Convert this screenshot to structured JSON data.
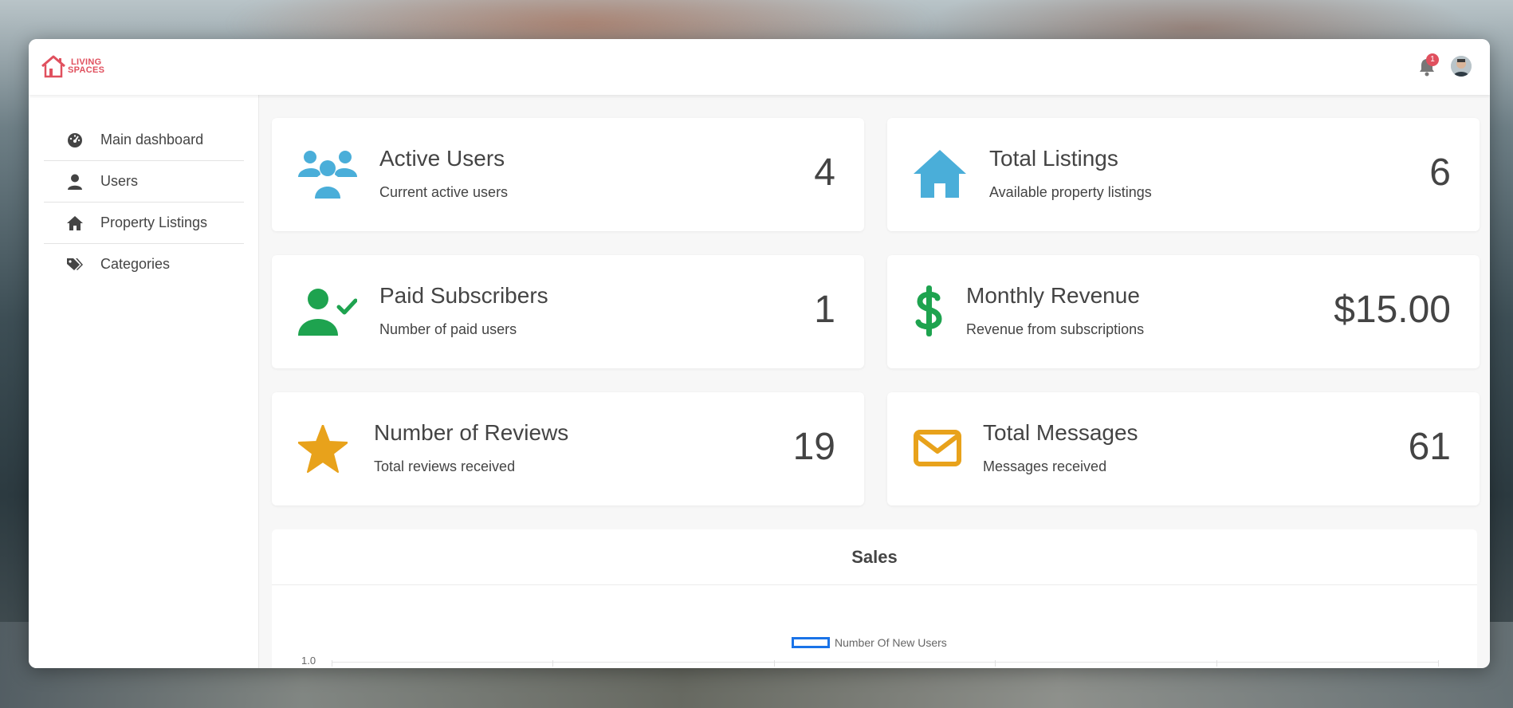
{
  "app": {
    "logo_line1": "LIVING",
    "logo_line2": "SPACES",
    "notification_count": "1",
    "brand_color": "#e0505e"
  },
  "sidebar": {
    "items": [
      {
        "label": "Main dashboard",
        "icon": "gauge-icon"
      },
      {
        "label": "Users",
        "icon": "user-icon"
      },
      {
        "label": "Property Listings",
        "icon": "home-icon"
      },
      {
        "label": "Categories",
        "icon": "tags-icon"
      }
    ]
  },
  "stats": {
    "active_users": {
      "title": "Active Users",
      "subtitle": "Current active users",
      "value": "4",
      "icon": "users-group-icon",
      "color": "#4aaed9"
    },
    "total_listings": {
      "title": "Total Listings",
      "subtitle": "Available property listings",
      "value": "6",
      "icon": "house-icon",
      "color": "#4aaed9"
    },
    "paid_subscribers": {
      "title": "Paid Subscribers",
      "subtitle": "Number of paid users",
      "value": "1",
      "icon": "user-check-icon",
      "color": "#1ea34f"
    },
    "monthly_revenue": {
      "title": "Monthly Revenue",
      "subtitle": "Revenue from subscriptions",
      "value": "$15.00",
      "icon": "dollar-icon",
      "color": "#1ea34f"
    },
    "reviews": {
      "title": "Number of Reviews",
      "subtitle": "Total reviews received",
      "value": "19",
      "icon": "star-icon",
      "color": "#e8a21b"
    },
    "messages": {
      "title": "Total Messages",
      "subtitle": "Messages received",
      "value": "61",
      "icon": "envelope-icon",
      "color": "#e8a21b"
    }
  },
  "sales": {
    "title": "Sales",
    "legend": "Number Of New Users",
    "ytick_top": "1.0",
    "series_color": "#1a73e8"
  }
}
